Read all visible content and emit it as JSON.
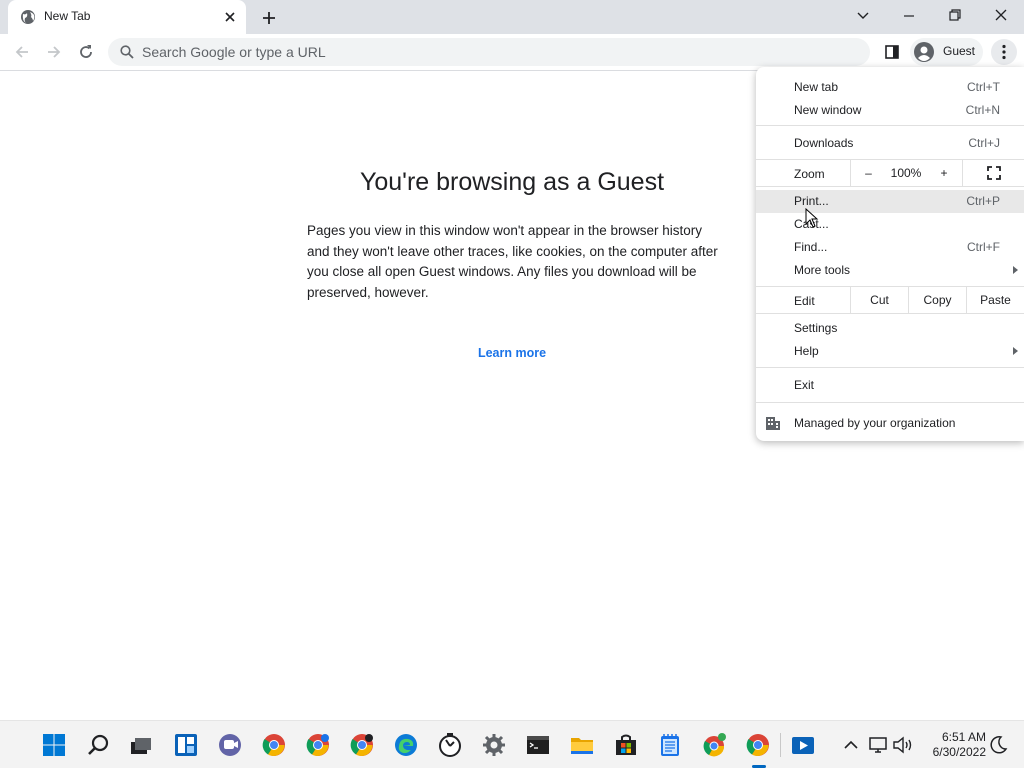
{
  "browser": {
    "tab_title": "New Tab",
    "omnibox_placeholder": "Search Google or type a URL",
    "profile_label": "Guest"
  },
  "page": {
    "title": "You're browsing as a Guest",
    "body": "Pages you view in this window won't appear in the browser history and they won't leave other traces, like cookies, on the computer after you close all open Guest windows. Any files you download will be preserved, however.",
    "learn_more": "Learn more"
  },
  "menu": {
    "new_tab": {
      "label": "New tab",
      "shortcut": "Ctrl+T"
    },
    "new_window": {
      "label": "New window",
      "shortcut": "Ctrl+N"
    },
    "downloads": {
      "label": "Downloads",
      "shortcut": "Ctrl+J"
    },
    "zoom": {
      "label": "Zoom",
      "minus": "–",
      "value": "100%",
      "plus": "+"
    },
    "print": {
      "label": "Print...",
      "shortcut": "Ctrl+P"
    },
    "cast": {
      "label": "Cast..."
    },
    "find": {
      "label": "Find...",
      "shortcut": "Ctrl+F"
    },
    "more_tools": {
      "label": "More tools"
    },
    "edit": {
      "label": "Edit",
      "cut": "Cut",
      "copy": "Copy",
      "paste": "Paste"
    },
    "settings": {
      "label": "Settings"
    },
    "help": {
      "label": "Help"
    },
    "exit": {
      "label": "Exit"
    },
    "managed": {
      "label": "Managed by your organization"
    }
  },
  "taskbar": {
    "time": "6:51 AM",
    "date": "6/30/2022"
  },
  "colors": {
    "accent": "#1a73e8",
    "tabstrip": "#dee1e6",
    "taskbar": "#f3f3f3"
  }
}
